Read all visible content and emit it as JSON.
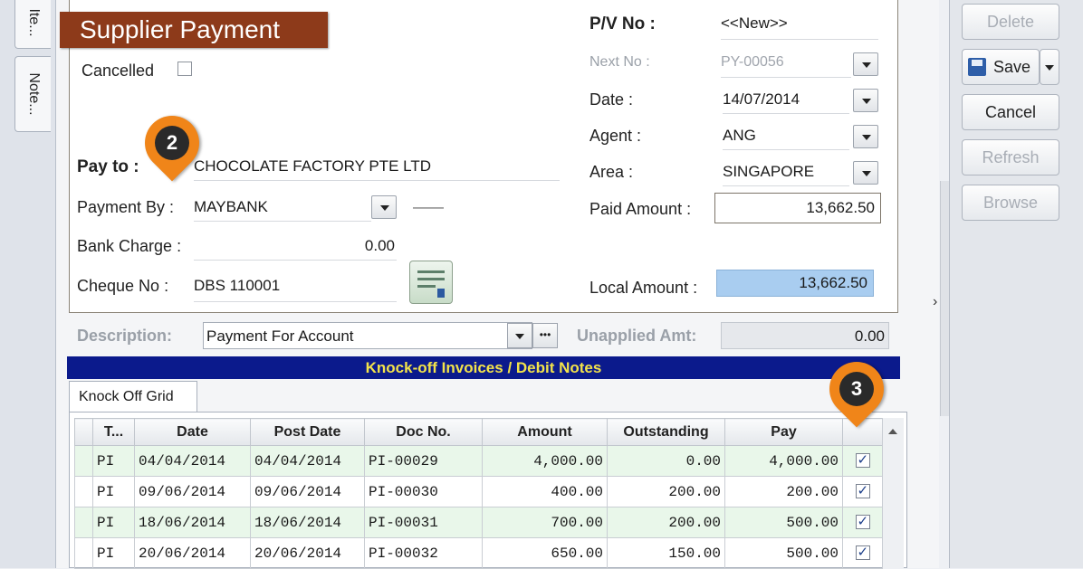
{
  "left_tabs": [
    {
      "label": "Ite..."
    },
    {
      "label": "Note..."
    }
  ],
  "title": "Supplier Payment",
  "form": {
    "cancelled_label": "Cancelled",
    "pay_to_label": "Pay to :",
    "pay_to_value": "CHOCOLATE FACTORY PTE LTD",
    "payment_by_label": "Payment By :",
    "payment_by_value": "MAYBANK",
    "payment_by_extra": "——",
    "bank_charge_label": "Bank Charge :",
    "bank_charge_value": "0.00",
    "cheque_no_label": "Cheque No :",
    "cheque_no_value": "DBS 110001",
    "pv_no_label": "P/V No :",
    "pv_no_value": "<<New>>",
    "next_no_label": "Next No :",
    "next_no_value": "PY-00056",
    "date_label": "Date :",
    "date_value": "14/07/2014",
    "agent_label": "Agent :",
    "agent_value": "ANG",
    "area_label": "Area :",
    "area_value": "SINGAPORE",
    "paid_amount_label": "Paid Amount :",
    "paid_amount_value": "13,662.50",
    "local_amount_label": "Local Amount :",
    "local_amount_value": "13,662.50",
    "description_label": "Description:",
    "description_value": "Payment For Account",
    "more_button": "•••",
    "unapplied_label": "Unapplied Amt:",
    "unapplied_value": "0.00"
  },
  "knockoff": {
    "bar_title": "Knock-off Invoices / Debit Notes",
    "tab_label": "Knock Off Grid",
    "columns": [
      "",
      "T...",
      "Date",
      "Post Date",
      "Doc No.",
      "Amount",
      "Outstanding",
      "Pay",
      ""
    ],
    "rows": [
      {
        "type": "PI",
        "date": "04/04/2014",
        "post_date": "04/04/2014",
        "doc_no": "PI-00029",
        "amount": "4,000.00",
        "outstanding": "0.00",
        "pay": "4,000.00",
        "checked": true
      },
      {
        "type": "PI",
        "date": "09/06/2014",
        "post_date": "09/06/2014",
        "doc_no": "PI-00030",
        "amount": "400.00",
        "outstanding": "200.00",
        "pay": "200.00",
        "checked": true
      },
      {
        "type": "PI",
        "date": "18/06/2014",
        "post_date": "18/06/2014",
        "doc_no": "PI-00031",
        "amount": "700.00",
        "outstanding": "200.00",
        "pay": "500.00",
        "checked": true
      },
      {
        "type": "PI",
        "date": "20/06/2014",
        "post_date": "20/06/2014",
        "doc_no": "PI-00032",
        "amount": "650.00",
        "outstanding": "150.00",
        "pay": "500.00",
        "checked": true
      }
    ]
  },
  "actions": {
    "delete": "Delete",
    "save": "Save",
    "cancel": "Cancel",
    "refresh": "Refresh",
    "browse": "Browse"
  },
  "markers": {
    "two": "2",
    "three": "3"
  },
  "colors": {
    "title_banner": "#8d3a1a",
    "knockoff_bar": "#0b1a8c",
    "knockoff_text": "#f3e34a",
    "marker": "#f08519",
    "local_amount_bg": "#a9cdf0"
  }
}
